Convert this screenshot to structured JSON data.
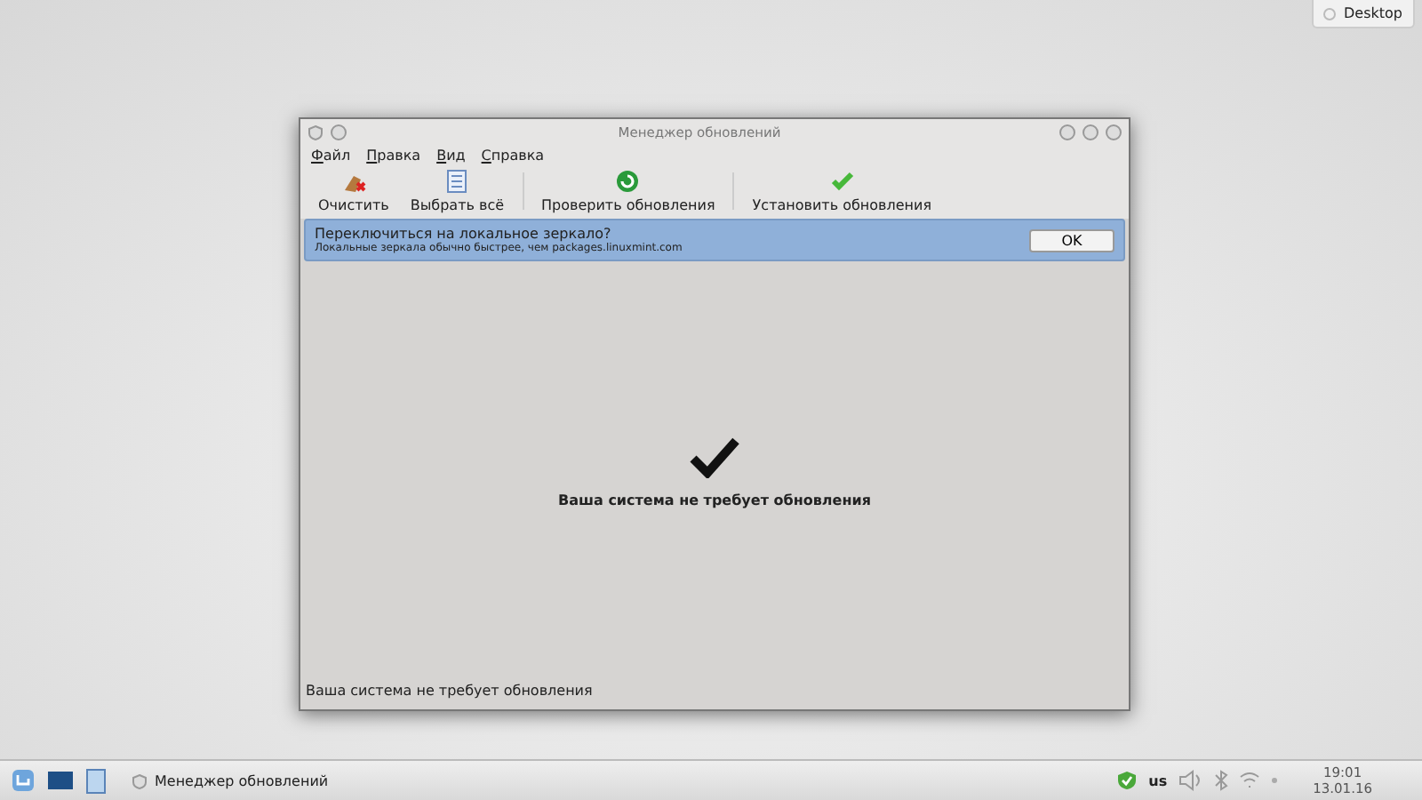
{
  "desktop_button": {
    "label": "Desktop"
  },
  "window": {
    "title": "Менеджер обновлений",
    "menu": [
      "Файл",
      "Правка",
      "Вид",
      "Справка"
    ],
    "toolbar": [
      {
        "label": "Очистить",
        "kind": "clear"
      },
      {
        "label": "Выбрать всё",
        "kind": "select"
      },
      {
        "label": "Проверить обновления",
        "kind": "refresh"
      },
      {
        "label": "Установить обновления",
        "kind": "install"
      }
    ],
    "banner": {
      "title": "Переключиться на локальное зеркало?",
      "text": "Локальные зеркала обычно быстрее, чем packages.linuxmint.com",
      "button": "OK"
    },
    "message": "Ваша система не требует обновления",
    "status_bar": "Ваша система не требует обновления"
  },
  "taskbar": {
    "task": "Менеджер обновлений",
    "keyboard": "us",
    "time": "19:01",
    "date": "13.01.16"
  }
}
